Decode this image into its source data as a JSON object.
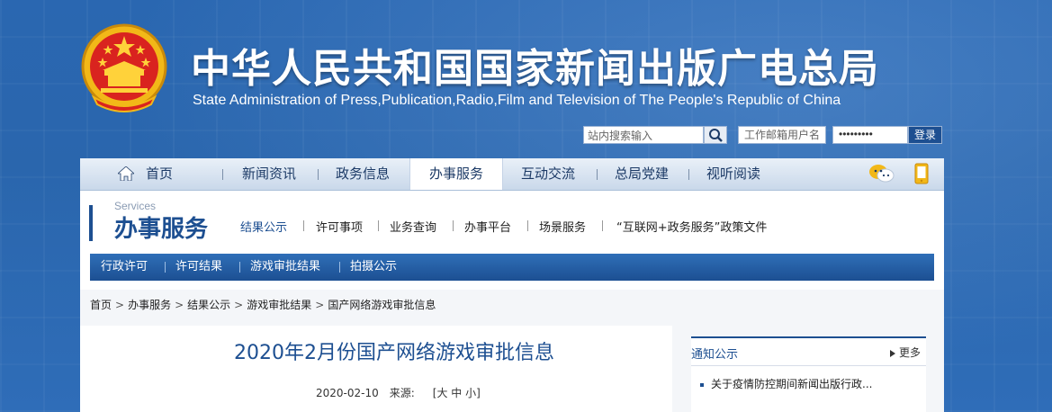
{
  "header": {
    "title_zh": "中华人民共和国国家新闻出版广电总局",
    "title_en": "State Administration of Press,Publication,Radio,Film and Television of The People's Republic of China"
  },
  "tools": {
    "search_placeholder": "站内搜索输入",
    "mail_placeholder": "工作邮箱用户名",
    "password_mask": "•••••••••",
    "login_label": "登录"
  },
  "nav": {
    "items": [
      {
        "label": "首页"
      },
      {
        "label": "新闻资讯"
      },
      {
        "label": "政务信息"
      },
      {
        "label": "办事服务"
      },
      {
        "label": "互动交流"
      },
      {
        "label": "总局党建"
      },
      {
        "label": "视听阅读"
      }
    ],
    "active_index": 3
  },
  "section": {
    "en": "Services",
    "zh": "办事服务",
    "subnav": [
      {
        "label": "结果公示"
      },
      {
        "label": "许可事项"
      },
      {
        "label": "业务查询"
      },
      {
        "label": "办事平台"
      },
      {
        "label": "场景服务"
      },
      {
        "label": "“互联网+政务服务”政策文件"
      }
    ]
  },
  "bluebar": {
    "items": [
      {
        "label": "行政许可"
      },
      {
        "label": "许可结果"
      },
      {
        "label": "游戏审批结果"
      },
      {
        "label": "拍摄公示"
      }
    ]
  },
  "breadcrumb": [
    "首页",
    "办事服务",
    "结果公示",
    "游戏审批结果",
    "国产网络游戏审批信息"
  ],
  "article": {
    "title": "2020年2月份国产网络游戏审批信息",
    "date": "2020-02-10",
    "source_label": "来源:",
    "font_size_label": "[大 中 小]"
  },
  "sidebar": {
    "title": "通知公示",
    "more_label": "更多",
    "items": [
      {
        "label": "关于疫情防控期间新闻出版行政..."
      }
    ]
  },
  "colors": {
    "brand_blue": "#1d4f91",
    "header_bg": "#2a67b1"
  }
}
